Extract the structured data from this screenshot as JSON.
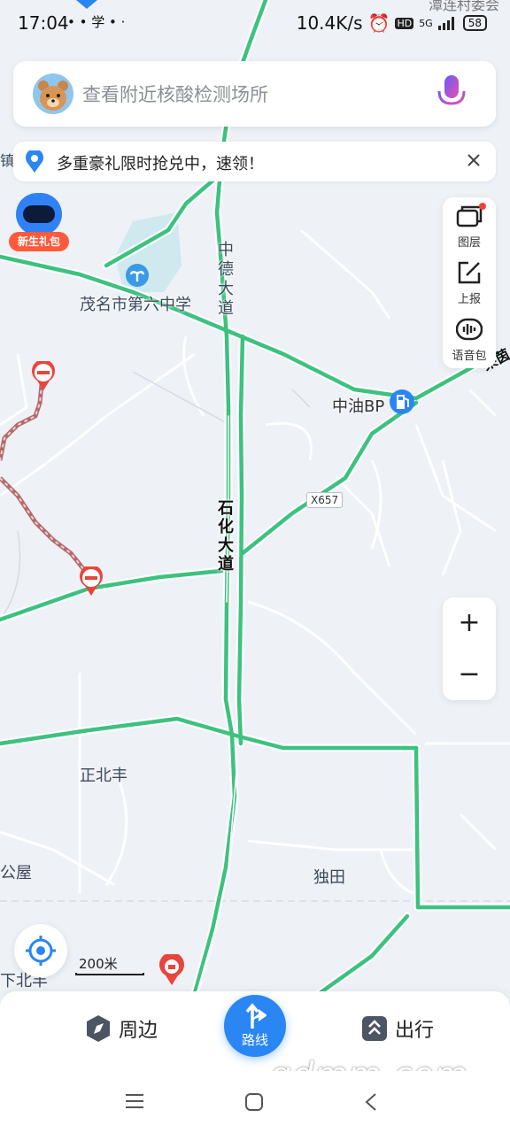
{
  "status_bar": {
    "time": "17:04",
    "notifications": "• • 学 • ·",
    "network_speed": "10.4K/s",
    "signal": "5G",
    "battery": "58"
  },
  "search": {
    "placeholder": "查看附近核酸检测场所"
  },
  "promo": {
    "text": "多重豪礼限时抢兑中，速领！"
  },
  "gift": {
    "label": "新生礼包"
  },
  "tools": {
    "layers": "图层",
    "report": "上报",
    "voice_pack": "语音包"
  },
  "zoom": {
    "in": "+",
    "out": "−"
  },
  "map": {
    "labels": {
      "road_zhongde": "中德大道",
      "school": "茂名市第六中学",
      "gas_station": "中油BP",
      "road_tag": "X657",
      "road_shihua": "石化大道",
      "village_zhengbeifeng": "正北丰",
      "village_dutian": "独田",
      "village_gongwu": "公屋",
      "village_xiabeifeng": "下北丰",
      "edge_lai": "莱茵",
      "edge_zhen": "镇",
      "top_right": "潭连村委会"
    },
    "scale": "200米"
  },
  "bottom_bar": {
    "nearby": "周边",
    "route": "路线",
    "travel": "出行"
  },
  "watermark": "gdmm.com"
}
